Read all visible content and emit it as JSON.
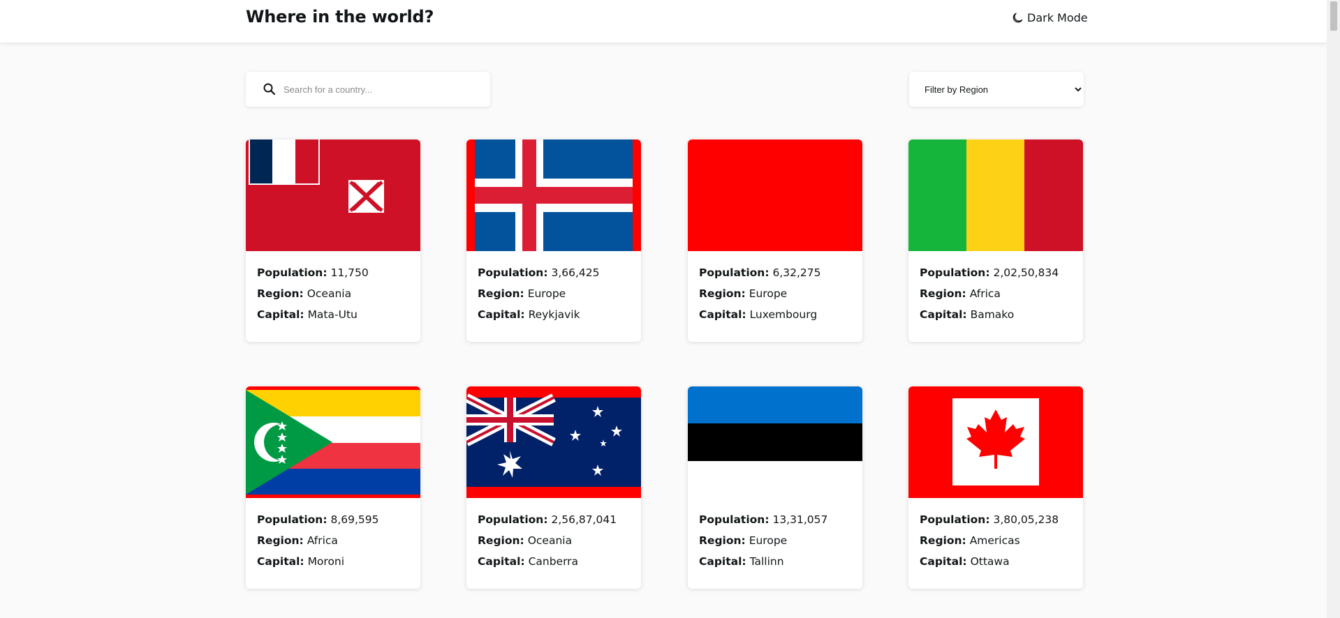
{
  "header": {
    "title": "Where in the world?",
    "mode_label": "Dark Mode"
  },
  "search": {
    "placeholder": "Search for a country...",
    "value": ""
  },
  "filter": {
    "selected": "Filter by Region"
  },
  "labels": {
    "population": "Population:",
    "region": "Region:",
    "capital": "Capital:"
  },
  "countries": [
    {
      "flag": "wallis-and-futuna",
      "population": "11,750",
      "region": "Oceania",
      "capital": "Mata-Utu"
    },
    {
      "flag": "iceland",
      "population": "3,66,425",
      "region": "Europe",
      "capital": "Reykjavik"
    },
    {
      "flag": "luxembourg",
      "population": "6,32,275",
      "region": "Europe",
      "capital": "Luxembourg"
    },
    {
      "flag": "mali",
      "population": "2,02,50,834",
      "region": "Africa",
      "capital": "Bamako"
    },
    {
      "flag": "comoros",
      "population": "8,69,595",
      "region": "Africa",
      "capital": "Moroni"
    },
    {
      "flag": "australia",
      "population": "2,56,87,041",
      "region": "Oceania",
      "capital": "Canberra"
    },
    {
      "flag": "estonia",
      "population": "13,31,057",
      "region": "Europe",
      "capital": "Tallinn"
    },
    {
      "flag": "canada",
      "population": "3,80,05,238",
      "region": "Americas",
      "capital": "Ottawa"
    }
  ]
}
